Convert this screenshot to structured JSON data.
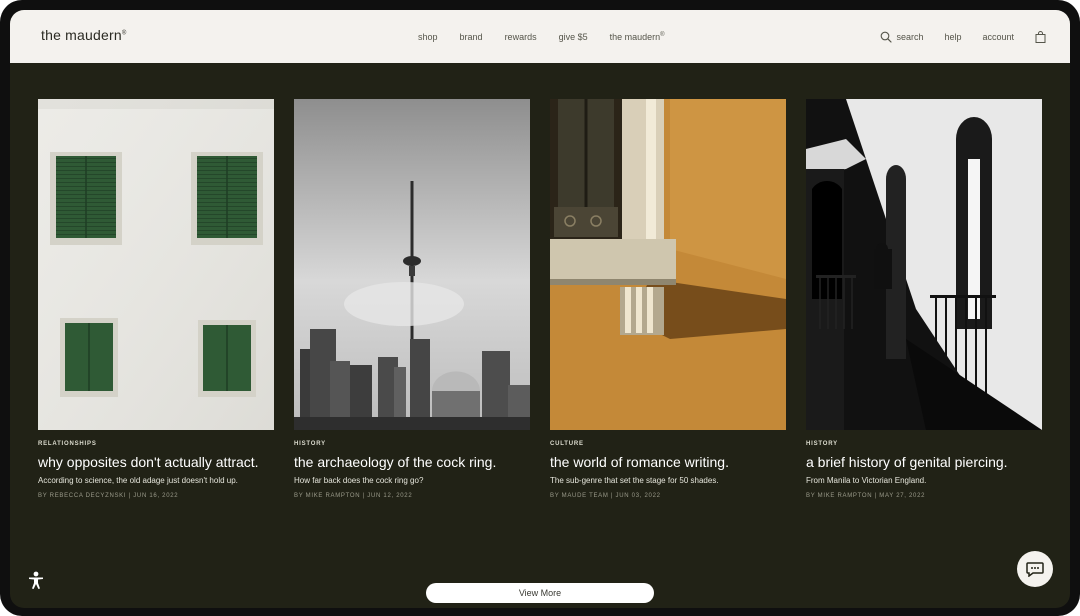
{
  "header": {
    "logo": "the maudern",
    "logo_mark": "®",
    "nav": {
      "shop": "shop",
      "brand": "brand",
      "rewards": "rewards",
      "give": "give $5",
      "maudern": "the maudern",
      "maudern_mark": "®"
    },
    "search_label": "search",
    "help_label": "help",
    "account_label": "account"
  },
  "articles": [
    {
      "category": "RELATIONSHIPS",
      "title": "why opposites don't actually attract.",
      "subtitle": "According to science, the old adage just doesn't hold up.",
      "meta": "BY REBECCA DECYZNSKI | JUN 16, 2022"
    },
    {
      "category": "HISTORY",
      "title": "the archaeology of the cock ring.",
      "subtitle": "How far back does the cock ring go?",
      "meta": "BY MIKE RAMPTON | JUN 12, 2022"
    },
    {
      "category": "CULTURE",
      "title": "the world of romance writing.",
      "subtitle": "The sub-genre that set the stage for 50 shades.",
      "meta": "BY MAUDE TEAM | JUN 03, 2022"
    },
    {
      "category": "HISTORY",
      "title": "a brief history of genital piercing.",
      "subtitle": "From Manila to Victorian England.",
      "meta": "BY MIKE RAMPTON | MAY 27, 2022"
    }
  ],
  "view_more_label": "View More",
  "colors": {
    "background": "#212216",
    "header": "#f4f2ee",
    "shutter_green": "#2f5a35",
    "ochre_wall": "#c98e3c"
  }
}
